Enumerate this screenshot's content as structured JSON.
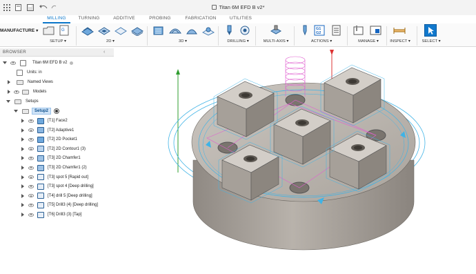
{
  "window": {
    "title": "Titan 6M EFD B v2*"
  },
  "workspace": {
    "label": "MANUFACTURE"
  },
  "tabs": [
    {
      "label": "MILLING"
    },
    {
      "label": "TURNING"
    },
    {
      "label": "ADDITIVE"
    },
    {
      "label": "PROBING"
    },
    {
      "label": "FABRICATION"
    },
    {
      "label": "UTILITIES"
    }
  ],
  "ribbon": {
    "setup": "SETUP ▾",
    "twod": "2D ▾",
    "threed": "3D ▾",
    "drilling": "DRILLING ▾",
    "multiaxis": "MULTI-AXIS ▾",
    "actions": "ACTIONS ▾",
    "manage": "MANAGE ▾",
    "inspect": "INSPECT ▾",
    "select": "SELECT ▾",
    "g1g2": "G1 G2"
  },
  "browser": {
    "title": "BROWSER",
    "root": "Titan 6M EFD B v2",
    "units": "Units: in",
    "named_views": "Named Views",
    "models": "Models",
    "setups": "Setups",
    "setup2": "Setup2",
    "operations": [
      "[T1] Face2",
      "[T2] Adaptive1",
      "[T2] 2D Pocket1",
      "[T2] 2D Contour1 (3)",
      "[T3] 2D Chamfer1",
      "[T3] 2D Chamfer1 (2)",
      "[T3] spot 5 [Rapid out]",
      "[T3] spot 4 [Deep drilling]",
      "[T4] drill 5 [Deep drilling]",
      "[T5] Drill3 (4) [Deep drilling]",
      "[T6] Drill3 (3) [Tap]"
    ]
  },
  "colors": {
    "accent": "#0a76c9",
    "selected_bg": "#cfe3f7",
    "toolpath_cyan": "#3fb3e6",
    "toolpath_magenta": "#e060d0",
    "part_gray": "#a9a39c"
  }
}
